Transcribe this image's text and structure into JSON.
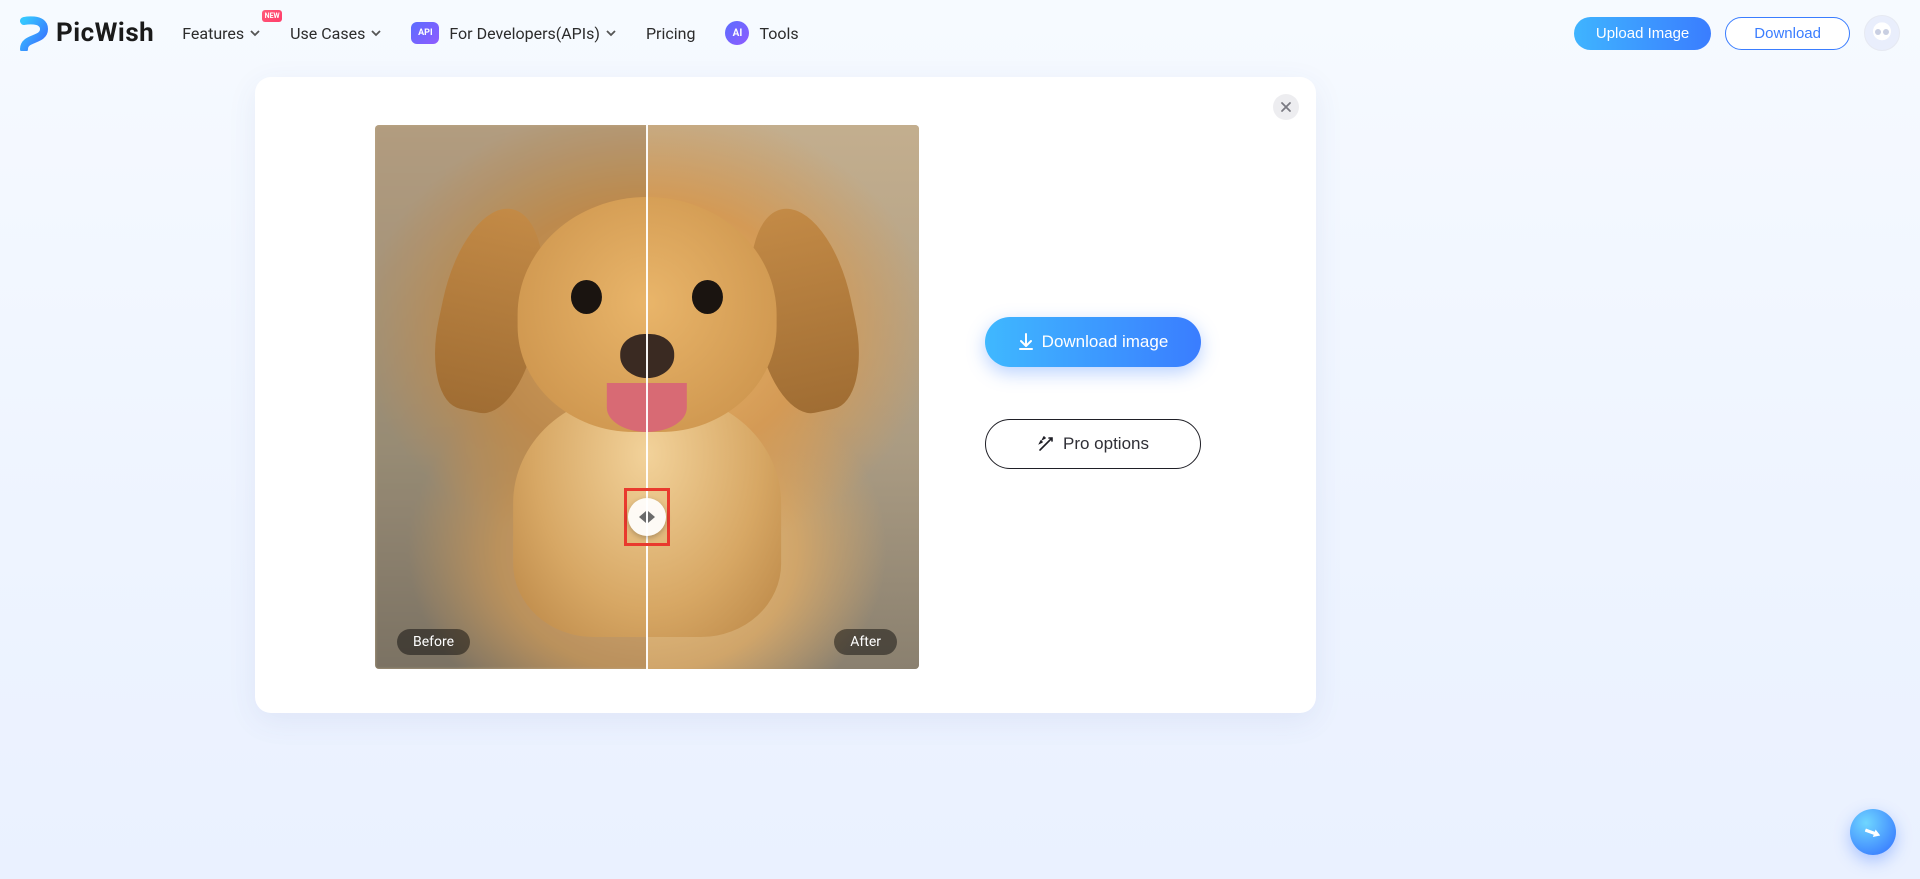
{
  "brand": {
    "name": "PicWish",
    "new_badge": "NEW"
  },
  "nav": {
    "features": "Features",
    "use_cases": "Use Cases",
    "for_devs": "For Developers(APIs)",
    "api_badge": "API",
    "pricing": "Pricing",
    "tools_badge": "AI",
    "tools": "Tools"
  },
  "header_buttons": {
    "upload": "Upload Image",
    "download": "Download"
  },
  "card": {
    "compare": {
      "before_label": "Before",
      "after_label": "After"
    },
    "actions": {
      "download_image": "Download image",
      "pro_options": "Pro options"
    }
  }
}
